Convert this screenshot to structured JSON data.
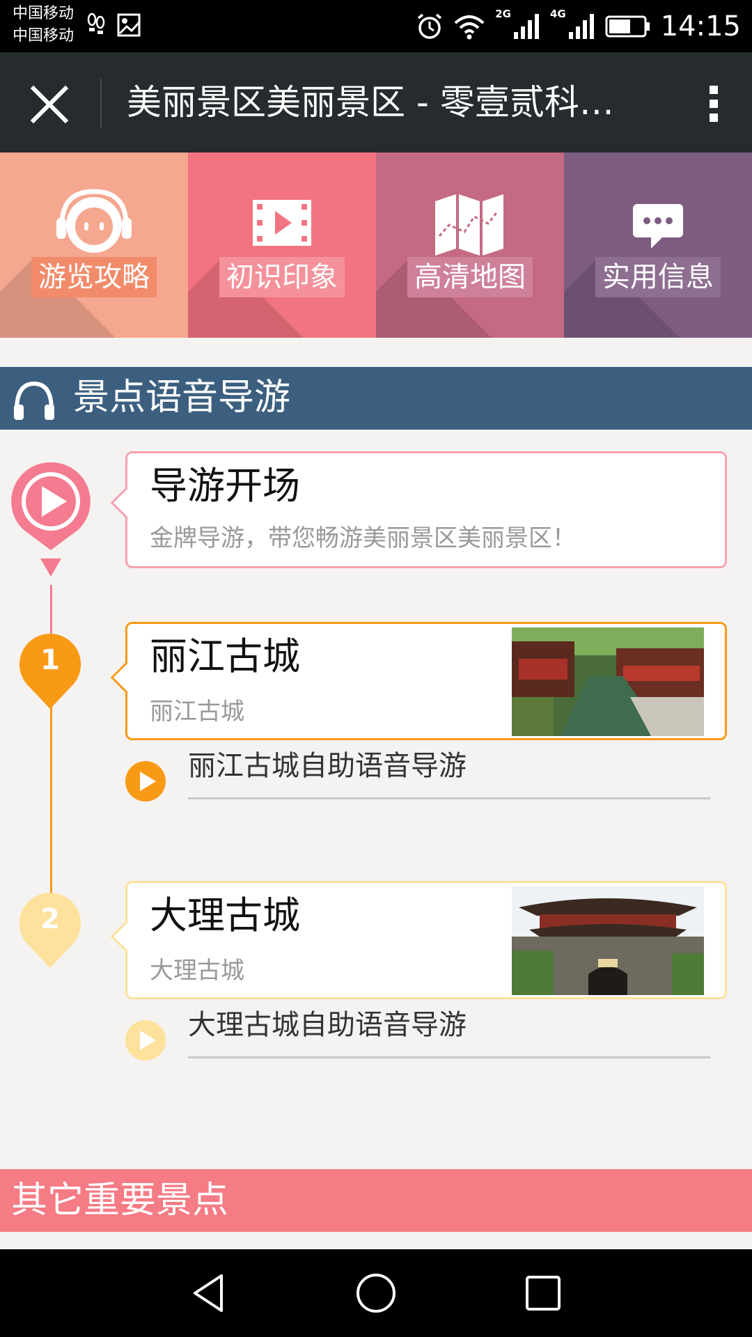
{
  "status_bar": {
    "carrier_1": "中国移动",
    "carrier_2": "中国移动",
    "net_2g": "2G",
    "net_4g": "4G",
    "time": "14:15"
  },
  "title_bar": {
    "title": "美丽景区美丽景区 - 零壹贰科…"
  },
  "menu_tiles": [
    {
      "label": "游览攻略",
      "icon": "mascot-headphones-icon",
      "color": "#f5a78f"
    },
    {
      "label": "初识印象",
      "icon": "film-icon",
      "color": "#f27480"
    },
    {
      "label": "高清地图",
      "icon": "map-icon",
      "color": "#c46a83"
    },
    {
      "label": "实用信息",
      "icon": "chat-bubble-icon",
      "color": "#7d5c80"
    }
  ],
  "voice_guide": {
    "title": "景点语音导游",
    "color": "#3c5f80"
  },
  "intro": {
    "title": "导游开场",
    "subtitle": "金牌导游，带您畅游美丽景区美丽景区！",
    "color": "#f57b90"
  },
  "spots": [
    {
      "number": "1",
      "title": "丽江古城",
      "subtitle": "丽江古城",
      "audio_label": "丽江古城自助语音导游",
      "color": "#f99a16"
    },
    {
      "number": "2",
      "title": "大理古城",
      "subtitle": "大理古城",
      "audio_label": "大理古城自助语音导游",
      "color": "#fde19c"
    }
  ],
  "other_section": {
    "title": "其它重要景点",
    "color": "#f57b84"
  }
}
